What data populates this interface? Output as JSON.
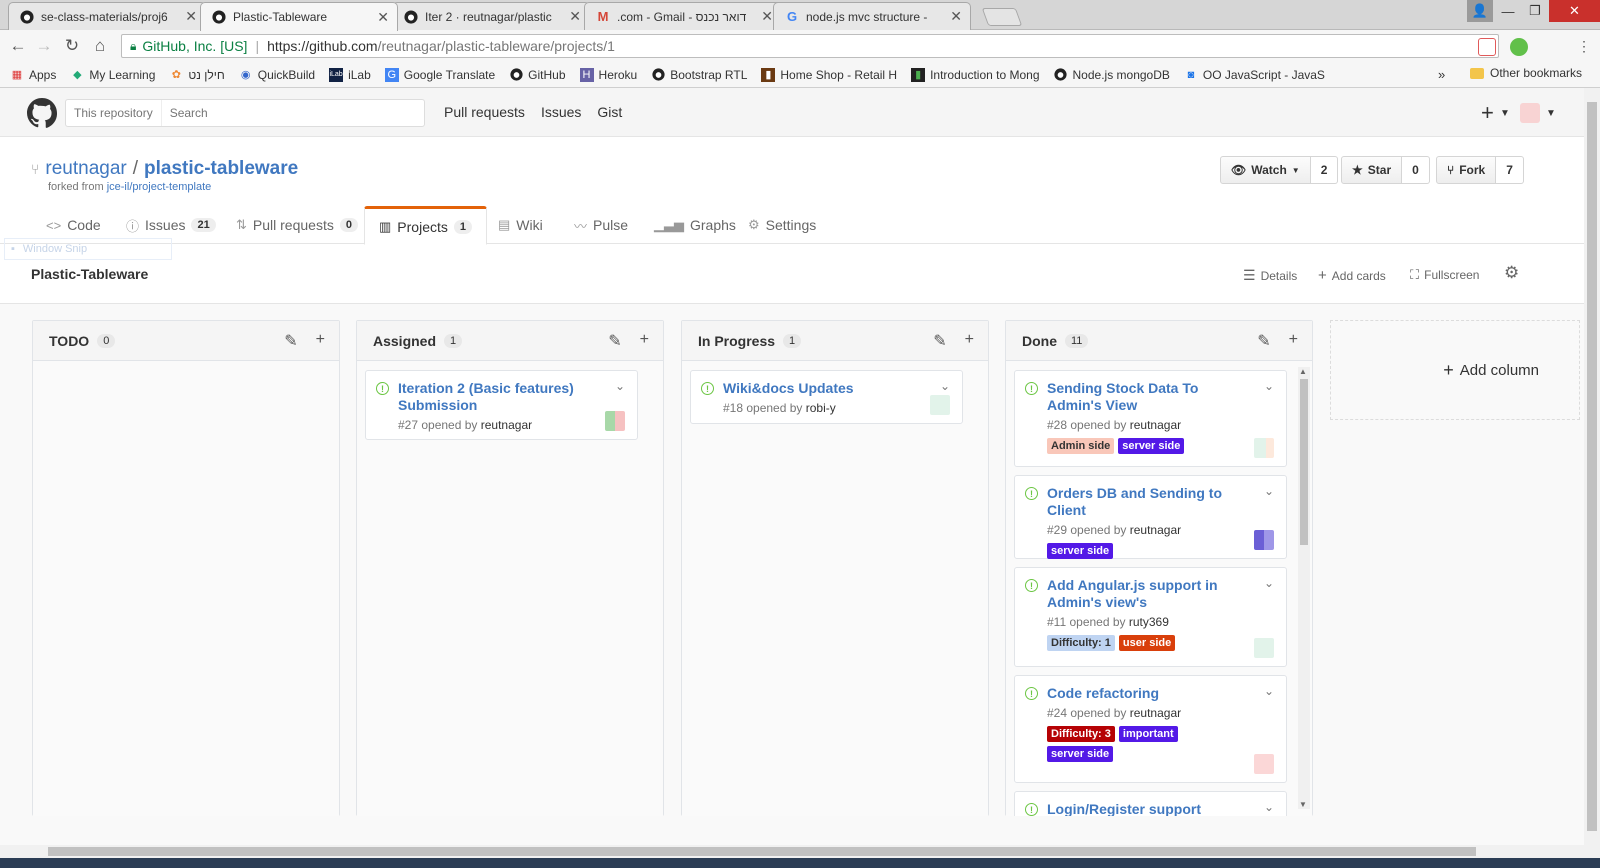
{
  "browser": {
    "tabs": [
      {
        "title": "se-class-materials/proj6",
        "icon": "github-icon"
      },
      {
        "title": "Plastic-Tableware",
        "icon": "github-icon",
        "active": true
      },
      {
        "title": "Iter 2 · reutnagar/plastic",
        "icon": "github-icon"
      },
      {
        "title": ".com - Gmail - דואר נכנס",
        "icon": "gmail-icon"
      },
      {
        "title": "node.js mvc structure - ",
        "icon": "google-icon"
      }
    ],
    "security_label": "GitHub, Inc. [US]",
    "url_host": "https://github.com",
    "url_path": "/reutnagar/plastic-tableware/projects/1",
    "bookmarks": [
      "Apps",
      "My Learning",
      "חילן נט",
      "QuickBuild",
      "iLab",
      "Google Translate",
      "GitHub",
      "Heroku",
      "Bootstrap RTL",
      "Home Shop - Retail H",
      "Introduction to Mong",
      "Node.js mongoDB",
      "OO JavaScript - JavaS"
    ],
    "bookmarks_more": "»",
    "other_bookmarks": "Other bookmarks"
  },
  "header": {
    "search_scope": "This repository",
    "search_placeholder": "Search",
    "nav": [
      "Pull requests",
      "Issues",
      "Gist"
    ]
  },
  "repo": {
    "owner": "reutnagar",
    "name": "plastic-tableware",
    "forked_prefix": "forked from",
    "forked_from": "jce-il/project-template",
    "watch_label": "Watch",
    "watch_count": "2",
    "star_label": "Star",
    "star_count": "0",
    "fork_label": "Fork",
    "fork_count": "7"
  },
  "repo_tabs": [
    {
      "label": "Code",
      "icon": "code-icon"
    },
    {
      "label": "Issues",
      "count": "21",
      "icon": "issue-icon"
    },
    {
      "label": "Pull requests",
      "count": "0",
      "icon": "pull-request-icon"
    },
    {
      "label": "Projects",
      "count": "1",
      "icon": "project-icon",
      "selected": true
    },
    {
      "label": "Wiki",
      "icon": "wiki-icon"
    },
    {
      "label": "Pulse",
      "icon": "pulse-icon"
    },
    {
      "label": "Graphs",
      "icon": "graph-icon"
    },
    {
      "label": "Settings",
      "icon": "gear-icon"
    }
  ],
  "window_snip": "Window Snip",
  "project": {
    "name": "Plastic-Tableware",
    "actions": [
      "Details",
      "Add cards",
      "Fullscreen"
    ],
    "add_column": "Add column"
  },
  "columns": [
    {
      "title": "TODO",
      "count": "0",
      "cards": []
    },
    {
      "title": "Assigned",
      "count": "1",
      "cards": [
        {
          "title": "Iteration 2 (Basic features) Submission",
          "meta": "#27 opened by",
          "author": "reutnagar",
          "labels": []
        }
      ]
    },
    {
      "title": "In Progress",
      "count": "1",
      "cards": [
        {
          "title": "Wiki&docs Updates",
          "meta": "#18 opened by",
          "author": "robi-y",
          "labels": []
        }
      ]
    },
    {
      "title": "Done",
      "count": "11",
      "cards": [
        {
          "title": "Sending Stock Data To Admin's View",
          "meta": "#28 opened by",
          "author": "reutnagar",
          "labels": [
            {
              "text": "Admin side",
              "bg": "#f9c7b9",
              "fg": "#333333"
            },
            {
              "text": "server side",
              "bg": "#5319e7",
              "fg": "#ffffff"
            }
          ]
        },
        {
          "title": "Orders DB and Sending to Client",
          "meta": "#29 opened by",
          "author": "reutnagar",
          "labels": [
            {
              "text": "server side",
              "bg": "#5319e7",
              "fg": "#ffffff"
            }
          ]
        },
        {
          "title": "Add Angular.js support in Admin's view's",
          "meta": "#11 opened by",
          "author": "ruty369",
          "labels": [
            {
              "text": "Difficulty: 1",
              "bg": "#bfd4f2",
              "fg": "#333333"
            },
            {
              "text": "user side",
              "bg": "#d93f0b",
              "fg": "#ffffff"
            }
          ]
        },
        {
          "title": "Code refactoring",
          "meta": "#24 opened by",
          "author": "reutnagar",
          "labels": [
            {
              "text": "Difficulty: 3",
              "bg": "#b60205",
              "fg": "#ffffff"
            },
            {
              "text": "important",
              "bg": "#5319e7",
              "fg": "#ffffff"
            },
            {
              "text": "server side",
              "bg": "#5319e7",
              "fg": "#ffffff"
            }
          ]
        },
        {
          "title": "Login/Register support",
          "meta": "",
          "author": "",
          "labels": []
        }
      ]
    }
  ],
  "colors": {
    "link": "#4078c0",
    "open_issue": "#6cc644",
    "selected_tab_accent": "#e36209"
  }
}
